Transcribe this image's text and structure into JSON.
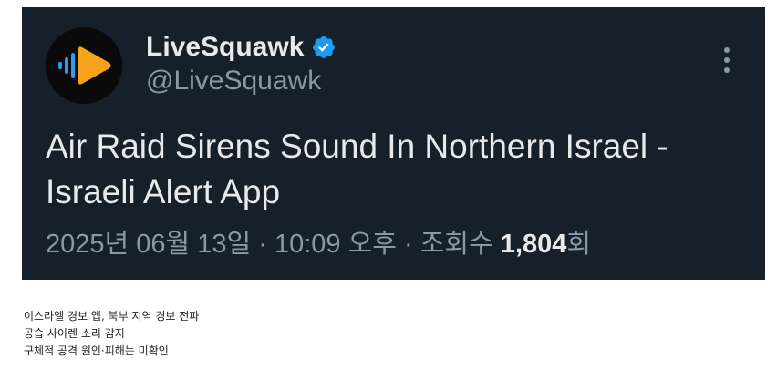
{
  "tweet": {
    "display_name": "LiveSquawk",
    "handle": "@LiveSquawk",
    "verified_icon": "verified-badge-icon",
    "text": "Air Raid Sirens Sound In Northern Israel - Israeli Alert App",
    "timestamp": "2025년 06월 13일 · 10:09 오후",
    "separator": " · ",
    "views_label": "조회수 ",
    "views_count": "1,804",
    "views_suffix": "회",
    "colors": {
      "background": "#15202b",
      "text": "#e7e9ea",
      "muted": "#8b98a5",
      "verified": "#1d9bf0",
      "avatar_accent": "#f7a21b"
    }
  },
  "caption": {
    "lines": [
      "이스라엘 경보 앱, 북부 지역 경보 전파",
      "공습 사이렌 소리 감지",
      "구체적 공격 원인·피해는 미확인"
    ]
  }
}
